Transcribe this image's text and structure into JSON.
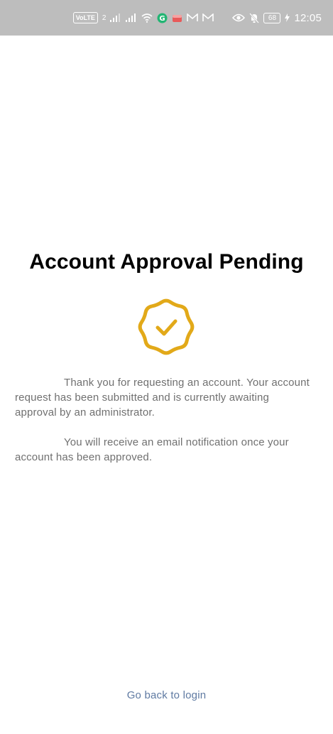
{
  "status_bar": {
    "volte_chip": "VoLTE",
    "sim_badge": "2",
    "battery_level": "68",
    "time": "12:05",
    "icons": [
      "signal-icon",
      "signal-icon",
      "wifi-icon",
      "grammarly-icon",
      "app-icon",
      "gmail-icon",
      "gmail-icon",
      "eye-icon",
      "mute-icon",
      "charging-icon"
    ]
  },
  "page": {
    "title": "Account Approval Pending",
    "message_1": "Thank you for requesting an account. Your account request has been submitted and is currently awaiting approval by an administrator.",
    "message_2": "You will receive an email notification once your account has been approved.",
    "back_link": "Go back to login"
  },
  "colors": {
    "status_bar_bg": "#bdbdbd",
    "badge": "#e2a919",
    "body_text": "#707070",
    "link": "#5f7aa2",
    "title": "#000000"
  }
}
